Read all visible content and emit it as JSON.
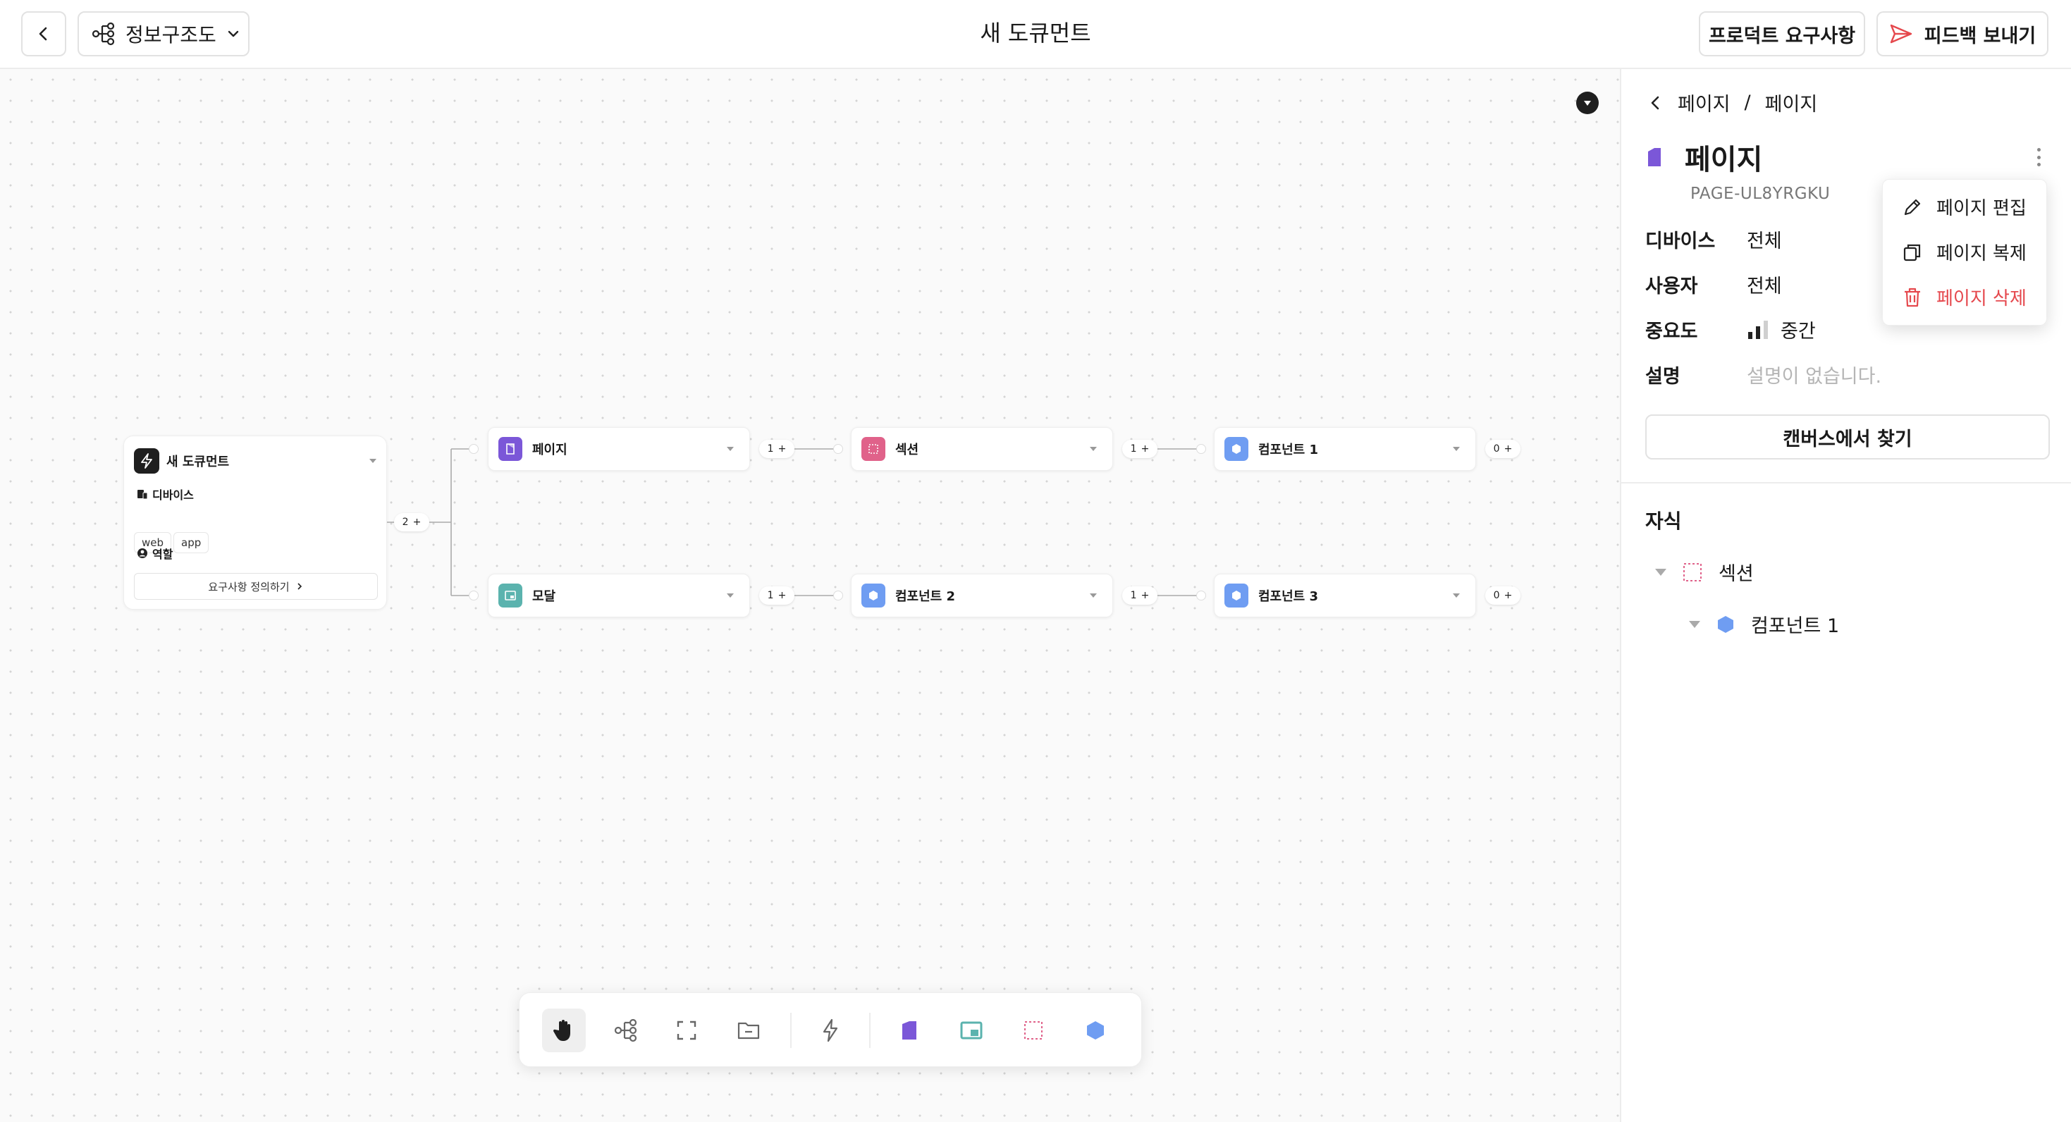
{
  "topbar": {
    "view_label": "정보구조도",
    "title": "새 도큐먼트",
    "requirements_label": "프로덕트 요구사항",
    "feedback_label": "피드백 보내기"
  },
  "canvas": {
    "root": {
      "title": "새 도큐먼트",
      "device_label": "디바이스",
      "chips": [
        "web",
        "app"
      ],
      "role_label": "역할",
      "cta_label": "요구사항 정의하기",
      "child_count": "2"
    },
    "rows": [
      {
        "nodes": [
          {
            "label": "페이지",
            "type": "page",
            "count": "1"
          },
          {
            "label": "섹션",
            "type": "section",
            "count": "1"
          },
          {
            "label": "컴포넌트 1",
            "type": "component",
            "count": "0"
          }
        ]
      },
      {
        "nodes": [
          {
            "label": "모달",
            "type": "modal",
            "count": "1"
          },
          {
            "label": "컴포넌트 2",
            "type": "component",
            "count": "1"
          },
          {
            "label": "컴포넌트 3",
            "type": "component",
            "count": "0"
          }
        ]
      }
    ],
    "toolbar": [
      "hand-tool",
      "tree-tool",
      "fit-tool",
      "folder-tool",
      "bolt-tool",
      "page-tool",
      "modal-tool",
      "section-tool",
      "component-tool"
    ]
  },
  "panel": {
    "breadcrumb": [
      "페이지",
      "/",
      "페이지"
    ],
    "page_title": "페이지",
    "page_code": "PAGE-UL8YRGKU",
    "props": {
      "device": {
        "key": "디바이스",
        "value": "전체"
      },
      "user": {
        "key": "사용자",
        "value": "전체"
      },
      "importance": {
        "key": "중요도",
        "value": "중간",
        "level": 0.66
      },
      "description": {
        "key": "설명",
        "placeholder": "설명이 없습니다."
      }
    },
    "find_label": "캔버스에서 찾기",
    "children_title": "자식",
    "tree": [
      {
        "label": "섹션",
        "type": "section"
      },
      {
        "label": "컴포넌트 1",
        "type": "component"
      }
    ]
  },
  "menu": {
    "edit": "페이지 편집",
    "duplicate": "페이지 복제",
    "delete": "페이지 삭제"
  },
  "colors": {
    "page": "#7b57d8",
    "section": "#e0628a",
    "modal": "#5bb3ae",
    "component": "#6f9df2",
    "danger": "#e5484d"
  }
}
